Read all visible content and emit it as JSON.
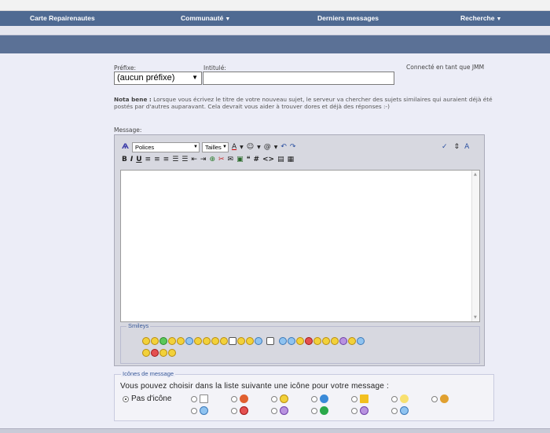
{
  "nav": {
    "items": [
      {
        "label": "Carte Repairenautes",
        "caret": false
      },
      {
        "label": "Communauté",
        "caret": true
      },
      {
        "label": "Derniers messages",
        "caret": false
      },
      {
        "label": "Recherche",
        "caret": true
      }
    ]
  },
  "form": {
    "prefix_label": "Préfixe:",
    "prefix_value": "(aucun préfixe)",
    "title_label": "Intitulé:",
    "title_value": "",
    "connected": "Connecté en tant que JMM",
    "note_bold": "Nota bene :",
    "note_text": " Lorsque vous écrivez le titre de votre nouveau sujet, le serveur va chercher des sujets similaires qui auraient déjà été postés par d'autres auparavant. Cela devrait vous aider à trouver dores et déjà des réponses :-)",
    "message_label": "Message:"
  },
  "toolbar": {
    "font_combo": "Polices",
    "size_combo": "Tailles"
  },
  "smileys": {
    "legend": "Smileys",
    "row1": [
      "smile",
      "grin",
      "mad-green",
      "laugh",
      "biggrin",
      "sleepy",
      "confused",
      "frown",
      "wink",
      "cool-hat",
      "rolleyes",
      "drool",
      "eek",
      "pirate",
      "skull",
      "sunglasses",
      "happy",
      "nerd",
      "devil",
      "kiss",
      "tongue",
      "tongue2",
      "shocked",
      "sad",
      "blush"
    ],
    "row2": [
      "sad2",
      "angry",
      "cry",
      "happy2"
    ]
  },
  "message_icons": {
    "legend": "Icônes de message",
    "instruction": "Vous pouvez choisir dans la liste suivante une icône pour votre message :",
    "no_icon_label": "Pas d'icône",
    "icons": [
      "document",
      "thumbs-down",
      "smile",
      "question",
      "warning",
      "lightbulb",
      "thumbs-up",
      "cool",
      "angry",
      "tongue",
      "arrow",
      "biggrin",
      "smile2"
    ]
  },
  "colors": {
    "nav_bg": "#4f6a92",
    "band_bg": "#5b7196",
    "page_bg": "#ecedf7",
    "legend_color": "#3b5b9a"
  }
}
